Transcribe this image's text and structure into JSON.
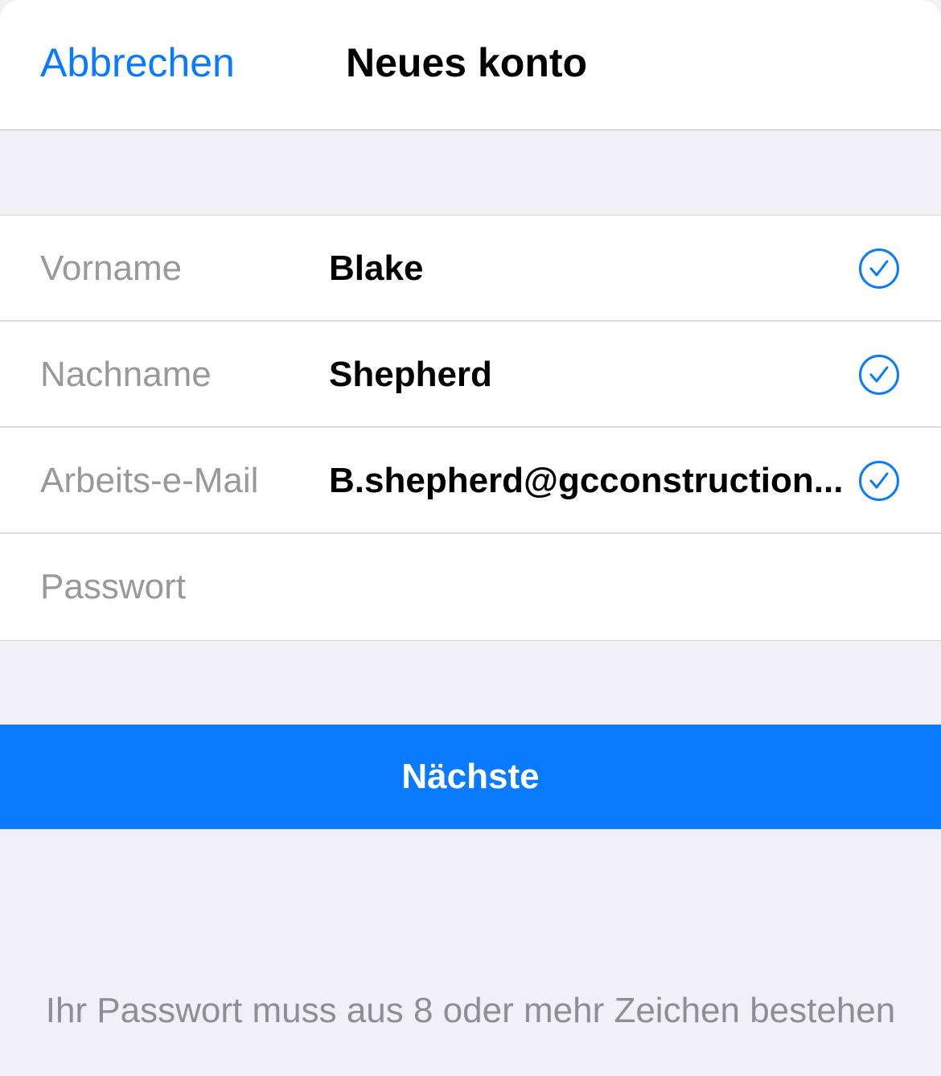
{
  "navbar": {
    "cancel_label": "Abbrechen",
    "title": "Neues konto"
  },
  "form": {
    "fields": [
      {
        "label": "Vorname",
        "value": "Blake",
        "valid": true,
        "icon": "checkmark-circle-icon"
      },
      {
        "label": "Nachname",
        "value": "Shepherd",
        "valid": true,
        "icon": "checkmark-circle-icon"
      },
      {
        "label": "Arbeits-e-Mail",
        "value": "B.shepherd@gcconstruction...",
        "valid": true,
        "icon": "checkmark-circle-icon"
      },
      {
        "label": "Passwort",
        "value": "",
        "valid": false
      }
    ]
  },
  "next_button": {
    "label": "Nächste"
  },
  "hint_text": "Ihr Passwort muss aus 8 oder mehr Zeichen bestehen",
  "colors": {
    "accent": "#0a7aff",
    "background": "#f0f0f5",
    "label_gray": "#98989d"
  }
}
